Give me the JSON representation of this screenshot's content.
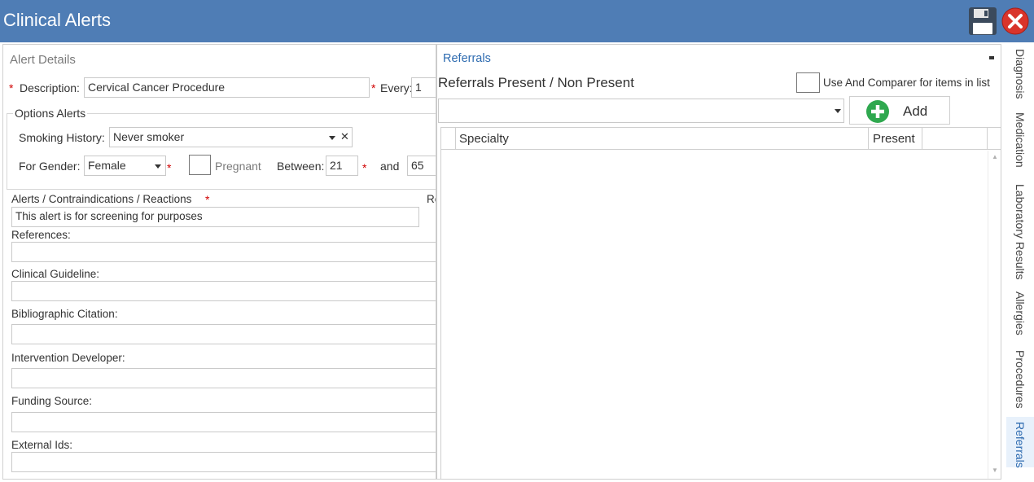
{
  "window": {
    "title": "Clinical Alerts"
  },
  "alert_details": {
    "section_title": "Alert Details",
    "description_label": "Description:",
    "description_value": "Cervical Cancer Procedure",
    "every_label": "Every:",
    "every_value": "1",
    "options_title": "Options Alerts",
    "smoking_label": "Smoking History:",
    "smoking_value": "Never smoker",
    "gender_label": "For Gender:",
    "gender_value": "Female",
    "pregnant_label": "Pregnant",
    "between_label": "Between:",
    "age_from": "21",
    "and_label": "and",
    "age_to": "65",
    "alerts_label": "Alerts / Contraindications / Reactions",
    "alerts_value": "This alert is for screening for purposes",
    "cut_label": "Re",
    "references_label": "References:",
    "guideline_label": "Clinical Guideline:",
    "citation_label": "Bibliographic Citation:",
    "developer_label": "Intervention Developer:",
    "funding_label": "Funding Source:",
    "external_label": "External Ids:",
    "required_mark": "*",
    "clear_mark": "✕"
  },
  "referrals": {
    "section_title": "Referrals",
    "heading": "Referrals Present / Non Present",
    "comparer_label": "Use And Comparer for items in list",
    "add_label": "Add",
    "columns": [
      "Specialty",
      "Present"
    ]
  },
  "side_tabs": [
    "Diagnosis",
    "Medication",
    "Laboratory Results",
    "Allergies",
    "Procedures",
    "Referrals"
  ],
  "colors": {
    "titlebar": "#4f7db5",
    "accent": "#2e6bb0",
    "required": "#d00000",
    "add_icon": "#2fa84f",
    "close_icon": "#d9342b"
  }
}
